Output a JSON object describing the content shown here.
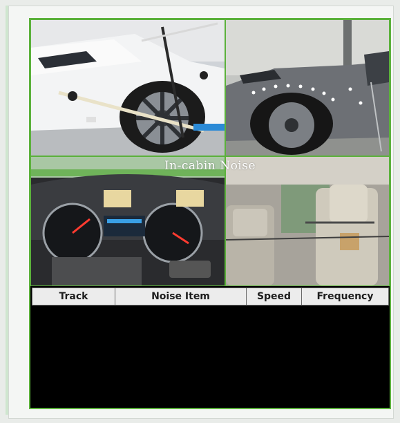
{
  "overlay": {
    "title": "In-cabin Noise"
  },
  "table": {
    "headers": [
      "Track",
      "Noise Item",
      "Speed",
      "Frequency"
    ]
  },
  "photos": [
    {
      "name": "white-car-wheel-rig-photo"
    },
    {
      "name": "gray-suv-sensor-photo"
    },
    {
      "name": "dashboard-cluster-photo"
    },
    {
      "name": "seat-headrest-mic-photo"
    }
  ]
}
